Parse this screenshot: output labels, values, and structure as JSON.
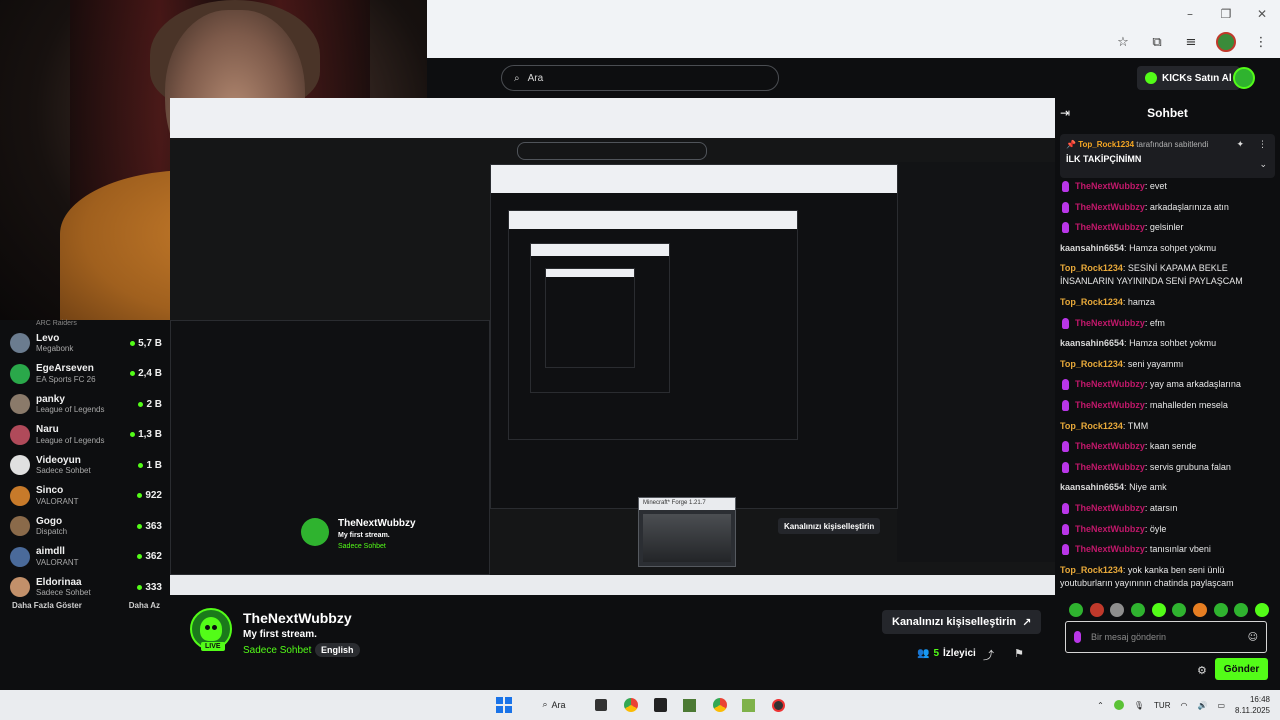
{
  "header": {
    "search_placeholder": "Ara",
    "kicks_button": "KICKs Satın Al"
  },
  "sidebar": {
    "top_partial": "ARC Raiders",
    "items": [
      {
        "name": "Levo",
        "category": "Megabonk",
        "viewers": "5,7 B",
        "color": "#6b7c8f"
      },
      {
        "name": "EgeArseven",
        "category": "EA Sports FC 26",
        "viewers": "2,4 B",
        "color": "#2aa84a"
      },
      {
        "name": "panky",
        "category": "League of Legends",
        "viewers": "2 B",
        "color": "#8a7a6a"
      },
      {
        "name": "Naru",
        "category": "League of Legends",
        "viewers": "1,3 B",
        "color": "#b04a5a"
      },
      {
        "name": "Videoyun",
        "category": "Sadece Sohbet",
        "viewers": "1 B",
        "color": "#e0e0e0"
      },
      {
        "name": "Sinco",
        "category": "VALORANT",
        "viewers": "922",
        "color": "#c77a2a"
      },
      {
        "name": "Gogo",
        "category": "Dispatch",
        "viewers": "363",
        "color": "#8a6a4a"
      },
      {
        "name": "aimdll",
        "category": "VALORANT",
        "viewers": "362",
        "color": "#4a6a9a"
      },
      {
        "name": "Eldorinaa",
        "category": "Sadece Sohbet",
        "viewers": "333",
        "color": "#c2906a"
      }
    ],
    "show_more": "Daha Fazla Göster",
    "show_less": "Daha Az"
  },
  "inner": {
    "popup_title": "Minecraft* Forge 1.21.7"
  },
  "stream": {
    "channel_name": "TheNextWubbzy",
    "title": "My first stream.",
    "category": "Sadece Sohbet",
    "language": "English",
    "live_tag": "LIVE",
    "customize_button": "Kanalınızı kişiselleştirin",
    "viewer_count": "5",
    "viewer_label": "İzleyici"
  },
  "chat": {
    "title": "Sohbet",
    "pinned_by_user": "Top_Rock1234",
    "pinned_by_suffix": "tarafından sabitlendi",
    "pinned_message": "İLK TAKİPÇİNİMN",
    "messages": [
      {
        "user": "TheNextWubbzy",
        "text": "evet",
        "type": "streamer"
      },
      {
        "user": "TheNextWubbzy",
        "text": "arkadaşlarınıza atın",
        "type": "streamer"
      },
      {
        "user": "TheNextWubbzy",
        "text": "gelsinler",
        "type": "streamer"
      },
      {
        "user": "kaansahin6654",
        "text": "Hamza sohpet yokmu",
        "type": "viewer"
      },
      {
        "user": "Top_Rock1234",
        "text": "SESİNİ KAPAMA BEKLE İNSANLARIN YAYININDA SENİ PAYLAŞCAM",
        "type": "mod"
      },
      {
        "user": "Top_Rock1234",
        "text": "hamza",
        "type": "mod"
      },
      {
        "user": "TheNextWubbzy",
        "text": "efm",
        "type": "streamer"
      },
      {
        "user": "kaansahin6654",
        "text": "Hamza sohbet yokmu",
        "type": "viewer"
      },
      {
        "user": "Top_Rock1234",
        "text": "seni yayammı",
        "type": "mod"
      },
      {
        "user": "TheNextWubbzy",
        "text": "yay ama arkadaşlarına",
        "type": "streamer"
      },
      {
        "user": "TheNextWubbzy",
        "text": "mahalleden mesela",
        "type": "streamer"
      },
      {
        "user": "Top_Rock1234",
        "text": "TMM",
        "type": "mod"
      },
      {
        "user": "TheNextWubbzy",
        "text": "kaan sende",
        "type": "streamer"
      },
      {
        "user": "TheNextWubbzy",
        "text": "servis grubuna falan",
        "type": "streamer"
      },
      {
        "user": "kaansahin6654",
        "text": "Niye amk",
        "type": "viewer"
      },
      {
        "user": "TheNextWubbzy",
        "text": "atarsın",
        "type": "streamer"
      },
      {
        "user": "TheNextWubbzy",
        "text": "öyle",
        "type": "streamer"
      },
      {
        "user": "TheNextWubbzy",
        "text": "tanısınlar vbeni",
        "type": "streamer"
      },
      {
        "user": "Top_Rock1234",
        "text": "yok kanka ben seni ünlü youtuburların yayınının chatinda paylaşcam",
        "type": "mod"
      }
    ],
    "input_placeholder": "Bir mesaj gönderin",
    "send_button": "Gönder"
  },
  "taskbar": {
    "search_label": "Ara",
    "lang": "TUR",
    "time": "16:48",
    "date": "8.11.2025"
  }
}
